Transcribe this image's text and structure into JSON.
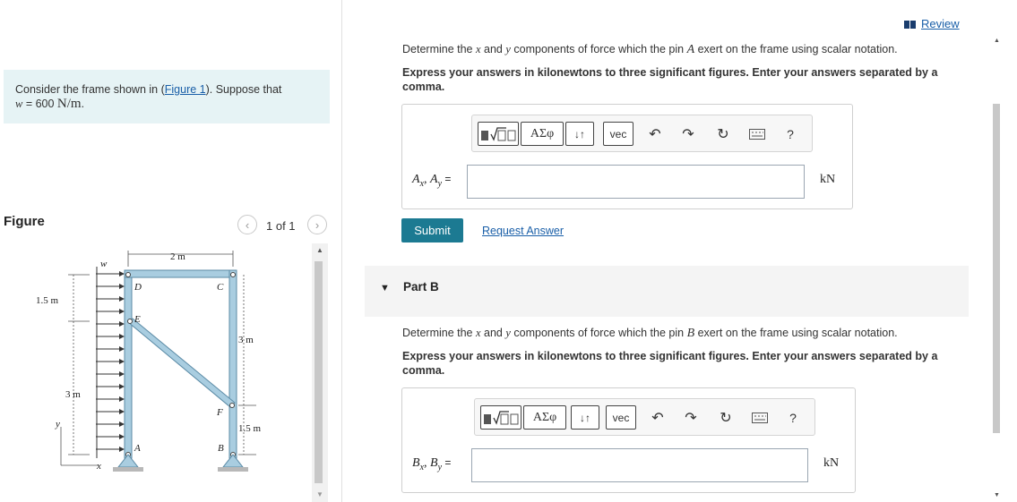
{
  "problem": {
    "intro": "Consider the frame shown in (",
    "figure_link": "Figure 1",
    "after_link": "). Suppose that",
    "w_var": "w",
    "w_eq": " = 600 ",
    "w_unit": "N/m",
    "w_end": "."
  },
  "figure_panel": {
    "title": "Figure",
    "counter": "1 of 1",
    "prev_icon": "chevron-left-icon",
    "next_icon": "chevron-right-icon",
    "labels": {
      "w": "w",
      "top_dim": "2 m",
      "D": "D",
      "C": "C",
      "E": "E",
      "F": "F",
      "A": "A",
      "B": "B",
      "left_dim_1": "1.5 m",
      "left_dim_2": "3 m",
      "right_dim_1": "3 m",
      "right_dim_2": "1.5 m",
      "y_axis": "y",
      "x_axis": "x"
    }
  },
  "review": {
    "label": "Review",
    "icon": "review-icon"
  },
  "part_a": {
    "prompt_pre": "Determine the ",
    "x_var": "x",
    "and": " and ",
    "y_var": "y",
    "prompt_mid": " components of force which the pin ",
    "pin": "A",
    "prompt_post": " exert on the frame using scalar notation.",
    "instruction": "Express your answers in kilonewtons to three significant figures. Enter your answers separated by a comma.",
    "label_x": "A",
    "label_x_sub": "x",
    "comma": ", ",
    "label_y": "A",
    "label_y_sub": "y",
    "equals": " =",
    "input_value": "",
    "unit": "kN"
  },
  "toolbar": {
    "greek_label": "ΑΣφ",
    "sort_label": "↓↑",
    "vec_label": "vec",
    "help_label": "?",
    "icons": [
      "templates-icon",
      "greek-icon",
      "sort-icon",
      "vec-icon",
      "undo-icon",
      "redo-icon",
      "reset-icon",
      "keyboard-icon",
      "help-icon"
    ]
  },
  "actions": {
    "submit": "Submit",
    "request": "Request Answer"
  },
  "part_b": {
    "title": "Part B",
    "prompt_pre": "Determine the ",
    "x_var": "x",
    "and": " and ",
    "y_var": "y",
    "prompt_mid": " components of force which the pin ",
    "pin": "B",
    "prompt_post": " exert on the frame using scalar notation.",
    "instruction": "Express your answers in kilonewtons to three significant figures. Enter your answers separated by a comma.",
    "label_x": "B",
    "label_x_sub": "x",
    "comma": ", ",
    "label_y": "B",
    "label_y_sub": "y",
    "equals": " =",
    "input_value": "",
    "unit": "kN"
  },
  "colors": {
    "accent": "#1c7a92",
    "link": "#1a5fa8",
    "problem_bg": "#e6f3f5",
    "member": "#a9cde0"
  }
}
